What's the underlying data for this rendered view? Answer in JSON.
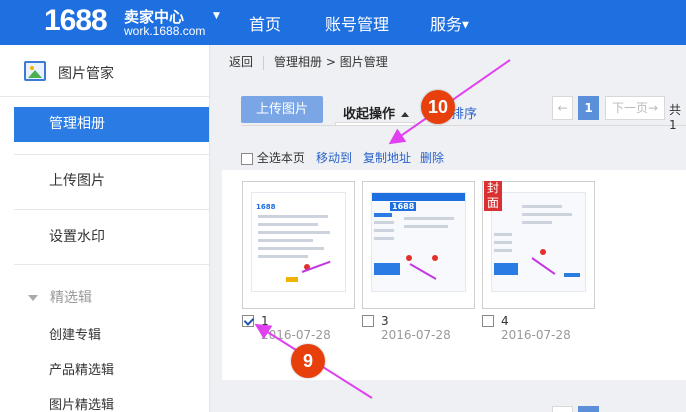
{
  "header": {
    "logo_number": "1688",
    "logo_title": "卖家中心",
    "logo_url": "work.1688.com",
    "nav": [
      {
        "label": "首页"
      },
      {
        "label": "账号管理"
      },
      {
        "label": "服务"
      }
    ]
  },
  "sidebar": {
    "title": "图片管家",
    "items": [
      {
        "label": "管理相册",
        "active": true
      },
      {
        "label": "上传图片"
      },
      {
        "label": "设置水印"
      }
    ],
    "group": {
      "label": "精选辑",
      "items": [
        {
          "label": "创建专辑"
        },
        {
          "label": "产品精选辑"
        },
        {
          "label": "图片精选辑"
        }
      ]
    }
  },
  "breadcrumb": {
    "back": "返回",
    "parent": "管理相册",
    "separator": ">",
    "current": "图片管理"
  },
  "toolbar": {
    "upload_label": "上传图片",
    "collapse_label": "收起操作",
    "sort_label": "排序"
  },
  "pagination": {
    "prev": "←",
    "current": "1",
    "next": "下一页→",
    "total_prefix": "共1"
  },
  "actions": {
    "select_all": "全选本页",
    "move_to": "移动到",
    "copy_address": "复制地址",
    "delete": "删除"
  },
  "photos": [
    {
      "name": "1",
      "date": "2016-07-28",
      "checked": true,
      "cover": false,
      "mini_logo": "1688"
    },
    {
      "name": "3",
      "date": "2016-07-28",
      "checked": false,
      "cover": false,
      "mini_logo": "1688"
    },
    {
      "name": "4",
      "date": "2016-07-28",
      "checked": false,
      "cover": true,
      "cover_label": "封面"
    }
  ],
  "markers": [
    {
      "label": "10"
    },
    {
      "label": "9"
    }
  ],
  "colors": {
    "header_bg": "#1e6fe0",
    "accent": "#2a7be4",
    "marker": "#e8400c",
    "arrow": "#e040f0"
  }
}
